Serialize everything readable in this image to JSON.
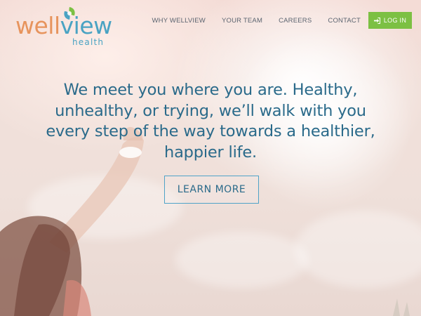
{
  "brand": {
    "name_part1": "well",
    "name_part2": "view",
    "subtitle": "health",
    "colors": {
      "orange": "#e7945d",
      "blue": "#4aa3c3",
      "green": "#7cc043"
    }
  },
  "nav": {
    "items": [
      {
        "label": "WHY WELLVIEW"
      },
      {
        "label": "YOUR TEAM"
      },
      {
        "label": "CAREERS"
      },
      {
        "label": "CONTACT"
      }
    ],
    "login_label": "LOG IN",
    "login_icon": "sign-in-icon"
  },
  "hero": {
    "headline": "We meet you where you are. Healthy, unhealthy, or trying, we’ll walk with you every step of the way towards a healthier, happier life.",
    "cta_label": "LEARN MORE",
    "headline_color": "#2a6a8a"
  }
}
